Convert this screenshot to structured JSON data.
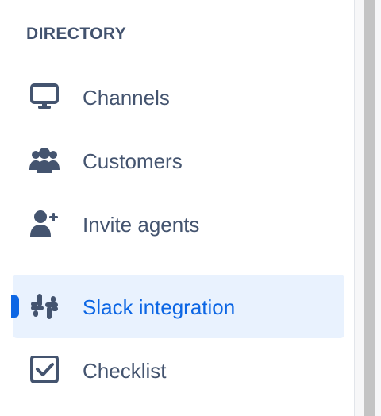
{
  "sidebar": {
    "section_title": "DIRECTORY",
    "items": [
      {
        "label": "Channels",
        "icon": "monitor-icon",
        "active": false
      },
      {
        "label": "Customers",
        "icon": "users-icon",
        "active": false
      },
      {
        "label": "Invite agents",
        "icon": "user-plus-icon",
        "active": false
      },
      {
        "label": "Slack integration",
        "icon": "slack-icon",
        "active": true
      },
      {
        "label": "Checklist",
        "icon": "checkbox-icon",
        "active": false
      }
    ]
  },
  "colors": {
    "text": "#44546f",
    "heading": "#42526e",
    "accent": "#0c66e4",
    "active_background": "#e9f2fe"
  }
}
